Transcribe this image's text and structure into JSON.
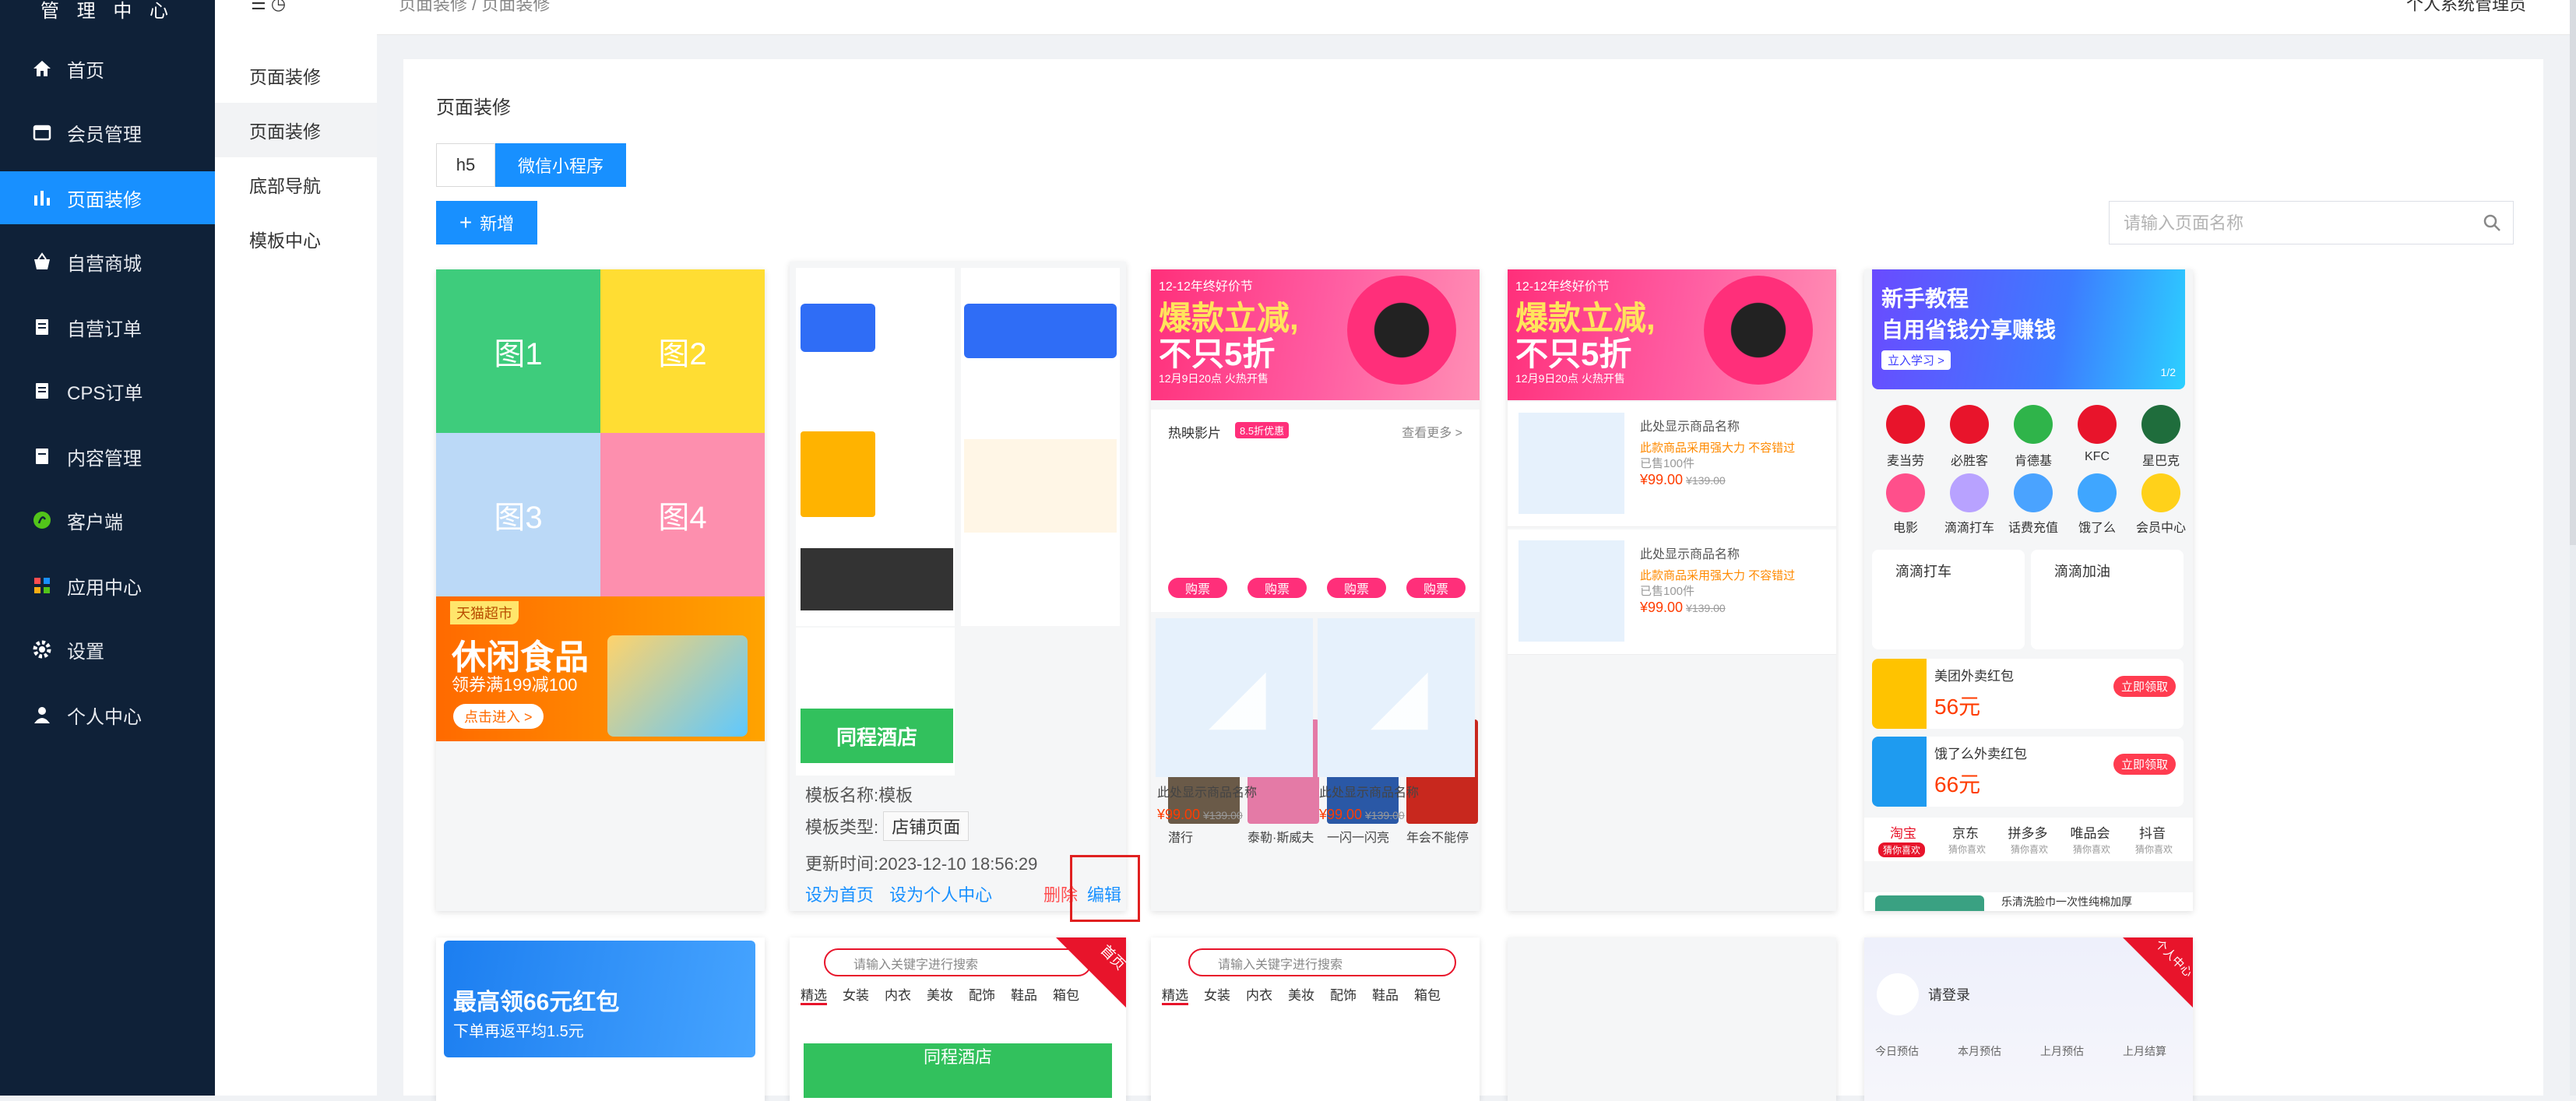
{
  "app": {
    "brand": "管 理 中 心",
    "breadcrumb": "页面装修  /  页面装修",
    "user": "个人系统管理员"
  },
  "sidebar": {
    "items": [
      {
        "label": "首页",
        "icon": "home-icon"
      },
      {
        "label": "会员管理",
        "icon": "member-icon"
      },
      {
        "label": "页面装修",
        "icon": "bar-chart-icon"
      },
      {
        "label": "自营商城",
        "icon": "basket-icon"
      },
      {
        "label": "自营订单",
        "icon": "order-icon"
      },
      {
        "label": "CPS订单",
        "icon": "cps-order-icon"
      },
      {
        "label": "内容管理",
        "icon": "content-icon"
      },
      {
        "label": "客户端",
        "icon": "client-icon"
      },
      {
        "label": "应用中心",
        "icon": "apps-icon"
      },
      {
        "label": "设置",
        "icon": "gear-icon"
      },
      {
        "label": "个人中心",
        "icon": "user-icon"
      }
    ]
  },
  "subnav": {
    "items": [
      "页面装修",
      "页面装修",
      "底部导航",
      "模板中心"
    ]
  },
  "main": {
    "title": "页面装修",
    "tabs": [
      "h5",
      "微信小程序"
    ],
    "add_label": "新增",
    "search_placeholder": "请输入页面名称"
  },
  "cards": {
    "c1": {
      "tiles": [
        "图1",
        "图2",
        "图3",
        "图4"
      ],
      "snack_tag": "天猫超市",
      "snack_title": "休闲食品",
      "snack_sub": "领券满199减100",
      "snack_btn": "点击进入 >"
    },
    "c2": {
      "name": "模板名称:模板",
      "type_label": "模板类型:",
      "type_value": "店铺页面",
      "updated": "更新时间:2023-12-10 18:56:29",
      "set_home": "设为首页",
      "set_center": "设为个人中心",
      "delete": "删除",
      "edit": "编辑",
      "hotel": "同程酒店"
    },
    "c3": {
      "banner_small": "12-12年终好价节",
      "banner_big1": "爆款立减,",
      "banner_big2": "不只5折",
      "banner_date": "12月9日20点 火热开售",
      "movies_title": "热映影片",
      "movies_badge": "8.5折优惠",
      "movies_more": "查看更多 >",
      "movie_names": [
        "潜行",
        "泰勒·斯威夫",
        "一闪一闪亮",
        "年会不能停"
      ],
      "buy": "购票",
      "product_name": "此处显示商品名称",
      "price": "¥99.00",
      "old_price": "¥139.00"
    },
    "c4": {
      "product_name": "此处显示商品名称",
      "product_desc": "此款商品采用强大力 不容错过",
      "sold": "已售100件",
      "price": "¥99.00",
      "old_price": "¥139.00"
    },
    "c5": {
      "banner_title": "新手教程",
      "banner_sub": "自用省钱分享赚钱",
      "banner_btn": "立入学习 >",
      "page": "1/2",
      "icons": [
        "麦当劳",
        "必胜客",
        "肯德基",
        "KFC",
        "星巴克",
        "电影",
        "滴滴打车",
        "话费充值",
        "饿了么",
        "会员中心"
      ],
      "didi_taxi": "滴滴打车",
      "didi_fuel": "滴滴加油",
      "meituan": "美团外卖红包",
      "meituan_amt": "56元",
      "eleme": "饿了么外卖红包",
      "eleme_amt": "66元",
      "claim": "立即领取",
      "platforms": [
        "淘宝",
        "京东",
        "拼多多",
        "唯品会",
        "抖音"
      ],
      "platform_sub": "猜你喜欢",
      "notice": "乐清洗脸巾一次性纯棉加厚"
    },
    "r2": {
      "eleme_title": "最高领66元红包",
      "eleme_sub": "下单再返平均1.5元",
      "search_ph": "请输入关键字进行搜索",
      "cats": [
        "精选",
        "女装",
        "内衣",
        "美妆",
        "配饰",
        "鞋品",
        "箱包"
      ],
      "ribbon_home": "首页",
      "ribbon_center": "个人中心",
      "login": "请登录",
      "stats": [
        "今日预估",
        "本月预估",
        "上月预估",
        "上月结算"
      ]
    }
  },
  "colors": {
    "accent": "#1890ff",
    "sidebar": "#0f2138",
    "danger": "#ff4d4f",
    "tile_green": "#3ecc7c",
    "tile_yellow": "#ffdd33",
    "tile_blue": "#bbd9f7",
    "tile_pink": "#fd8fae"
  }
}
